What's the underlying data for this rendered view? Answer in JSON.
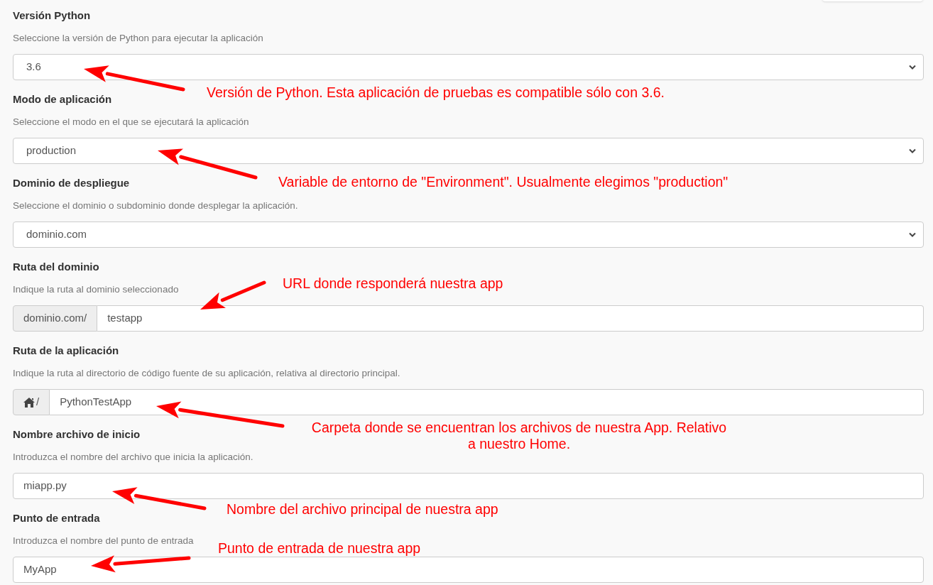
{
  "fields": [
    {
      "label": "Versión Python",
      "description": "Seleccione la versión de Python para ejecutar la aplicación",
      "kind": "select",
      "value": "3.6",
      "callout": [
        "Versión de Python. Esta aplicación de pruebas es compatible sólo con 3.6."
      ]
    },
    {
      "label": "Modo de aplicación",
      "description": "Seleccione el modo en el que se ejecutará la aplicación",
      "kind": "select",
      "value": "production",
      "callout": [
        "Variable de entorno de \"Environment\". Usualmente elegimos \"production\""
      ]
    },
    {
      "label": "Dominio de despliegue",
      "description": "Seleccione el dominio o subdominio donde desplegar la aplicación.",
      "kind": "select",
      "value": "dominio.com"
    },
    {
      "label": "Ruta del dominio",
      "description": "Indique la ruta al dominio seleccionado",
      "kind": "prefixed",
      "prefix": "dominio.com/",
      "value": "testapp",
      "callout": [
        "URL donde responderá nuestra app"
      ]
    },
    {
      "label": "Ruta de la aplicación",
      "description": "Indique la ruta al directorio de código fuente de su aplicación, relativa al directorio principal.",
      "kind": "home",
      "prefix": "/",
      "value": "PythonTestApp",
      "callout": [
        "Carpeta donde se encuentran los archivos de nuestra App. Relativo",
        "a nuestro Home."
      ]
    },
    {
      "label": "Nombre archivo de inicio",
      "description": "Introduzca el nombre del archivo que inicia la aplicación.",
      "kind": "text",
      "value": "miapp.py",
      "callout": [
        "Nombre del archivo principal de nuestra app"
      ]
    },
    {
      "label": "Punto de entrada",
      "description": "Introduzca el nombre del punto de entrada",
      "kind": "text",
      "value": "MyApp",
      "callout": [
        "Punto de entrada de nuestra app"
      ]
    }
  ]
}
